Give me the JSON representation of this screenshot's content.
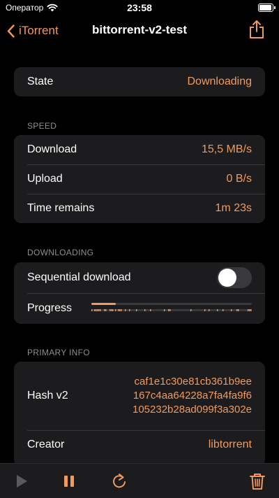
{
  "status_bar": {
    "carrier": "Оператор",
    "time": "23:58"
  },
  "nav": {
    "back_label": "iTorrent",
    "title": "bittorrent-v2-test"
  },
  "state": {
    "label": "State",
    "value": "Downloading"
  },
  "speed": {
    "header": "SPEED",
    "rows": [
      {
        "label": "Download",
        "value": "15,5 MB/s"
      },
      {
        "label": "Upload",
        "value": "0 B/s"
      },
      {
        "label": "Time remains",
        "value": "1m 23s"
      }
    ]
  },
  "downloading": {
    "header": "DOWNLOADING",
    "sequential_label": "Sequential download",
    "sequential_on": false,
    "progress_label": "Progress",
    "progress_fraction": 0.15
  },
  "primary_info": {
    "header": "PRIMARY INFO",
    "hash_label": "Hash v2",
    "hash_value": "caf1e1c30e81cb361b9ee167c4aa64228a7fa4fa9f6105232b28ad099f3a302e",
    "creator_label": "Creator",
    "creator_value": "libtorrent"
  },
  "colors": {
    "accent": "#f09a5d",
    "background": "#000000",
    "cell": "#1c1c1e",
    "secondary_text": "#8e8e93"
  },
  "toolbar": {
    "icons": [
      "play-icon",
      "pause-icon",
      "rehash-icon",
      "trash-icon"
    ]
  }
}
